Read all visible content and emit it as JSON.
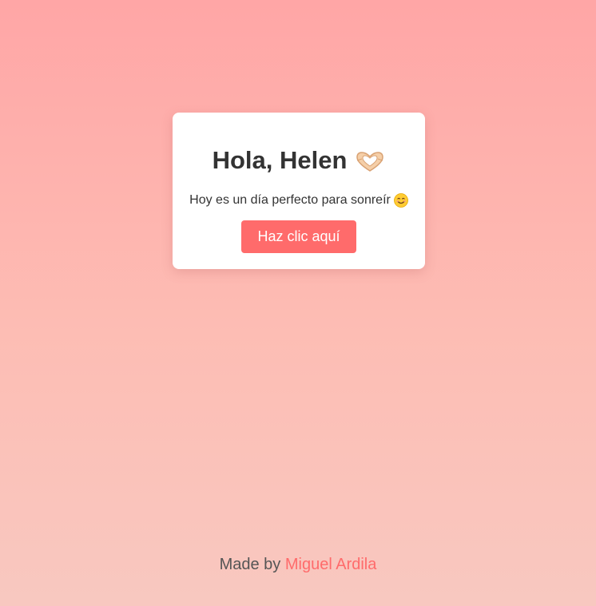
{
  "card": {
    "greeting": "Hola, Helen",
    "greeting_icon": "heart-hands-icon",
    "message": "Hoy es un día perfecto para sonreír",
    "message_icon": "smiling-face-icon",
    "button_label": "Haz clic aquí"
  },
  "footer": {
    "prefix": "Made by",
    "author": "Miguel Ardila"
  },
  "colors": {
    "accent": "#ff6b6b",
    "background_top": "#ffa6a6",
    "background_bottom": "#f8c8c0",
    "card": "#ffffff",
    "text": "#333333"
  }
}
